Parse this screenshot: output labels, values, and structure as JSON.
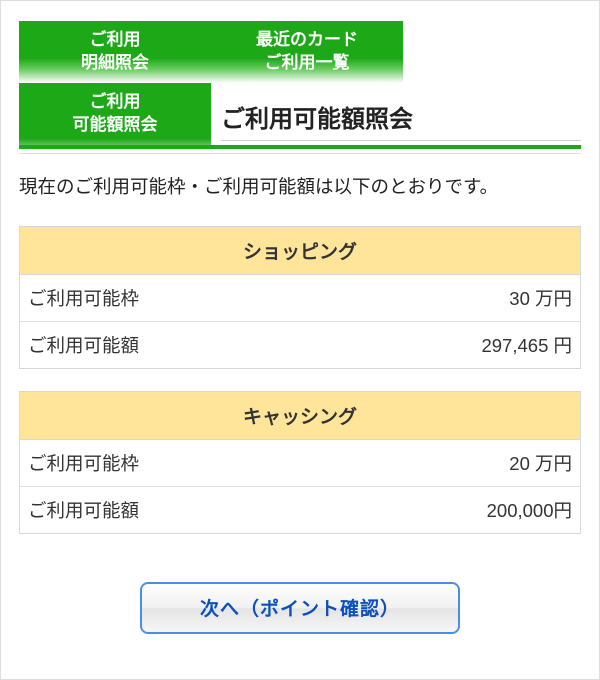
{
  "tabs": {
    "statement": {
      "line1": "ご利用",
      "line2": "明細照会"
    },
    "recent": {
      "line1": "最近のカード",
      "line2": "ご利用一覧"
    },
    "available": {
      "line1": "ご利用",
      "line2": "可能額照会"
    }
  },
  "page_title": "ご利用可能額照会",
  "intro_text": "現在のご利用可能枠・ご利用可能額は以下のとおりです。",
  "sections": {
    "shopping": {
      "header": "ショッピング",
      "rows": [
        {
          "label": "ご利用可能枠",
          "value": "30 万円"
        },
        {
          "label": "ご利用可能額",
          "value": "297,465 円"
        }
      ]
    },
    "cashing": {
      "header": "キャッシング",
      "rows": [
        {
          "label": "ご利用可能枠",
          "value": "20 万円"
        },
        {
          "label": "ご利用可能額",
          "value": "200,000円"
        }
      ]
    }
  },
  "buttons": {
    "next_label": "次へ（ポイント確認）"
  }
}
